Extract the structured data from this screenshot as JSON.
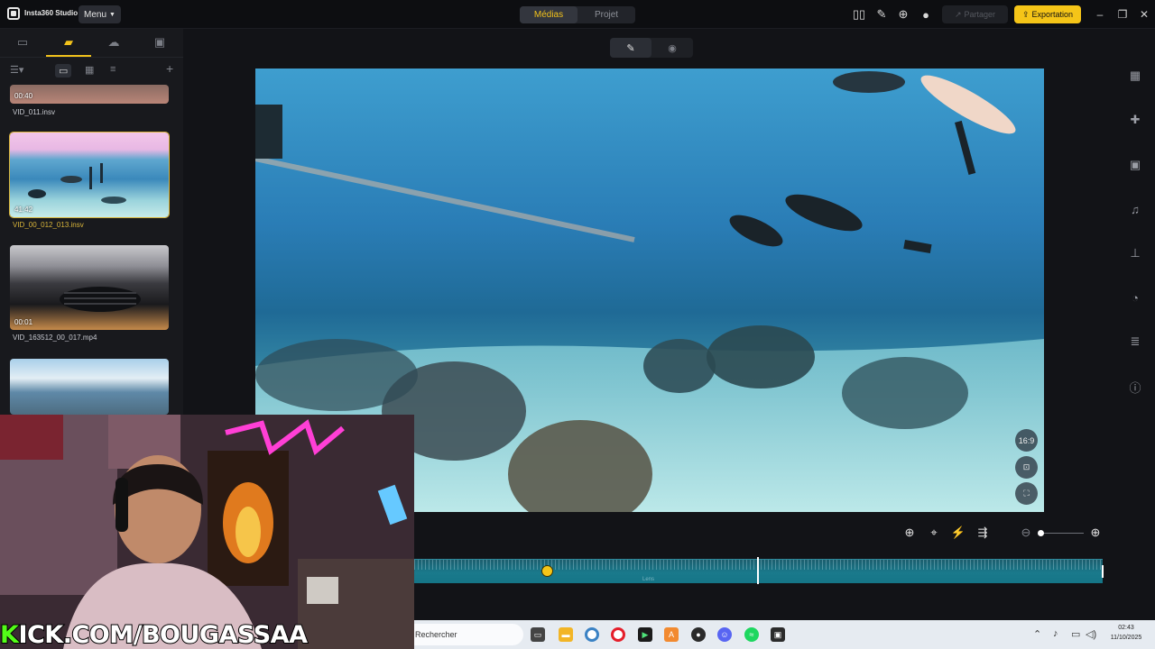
{
  "titlebar": {
    "app_name": "Insta360 Studio",
    "menu_label": "Menu",
    "tabs": [
      "Médias",
      "Projet"
    ],
    "active_tab": "Médias",
    "share_label": "Partager",
    "export_label": "Exportation"
  },
  "library": {
    "clips": [
      {
        "duration": "00:40",
        "name": "VID_011.insv"
      },
      {
        "duration": "41:42",
        "name": "VID_00_012_013.insv",
        "active": true
      },
      {
        "duration": "00:01",
        "name": "VID_163512_00_017.mp4"
      },
      {
        "duration": "",
        "name": ""
      }
    ]
  },
  "viewer": {
    "aspect_label": "16:9"
  },
  "timeline": {
    "mid_label": "Lens"
  },
  "overlay": {
    "kick_prefix": "K",
    "kick_text": "KICK.COM/BOUGASSAA"
  },
  "taskbar": {
    "search_placeholder": "Rechercher",
    "time": "02:43",
    "date": "11/10/2025"
  },
  "colors": {
    "accent": "#f5c518",
    "kick_green": "#53fc18",
    "track": "#1a7a8c"
  }
}
